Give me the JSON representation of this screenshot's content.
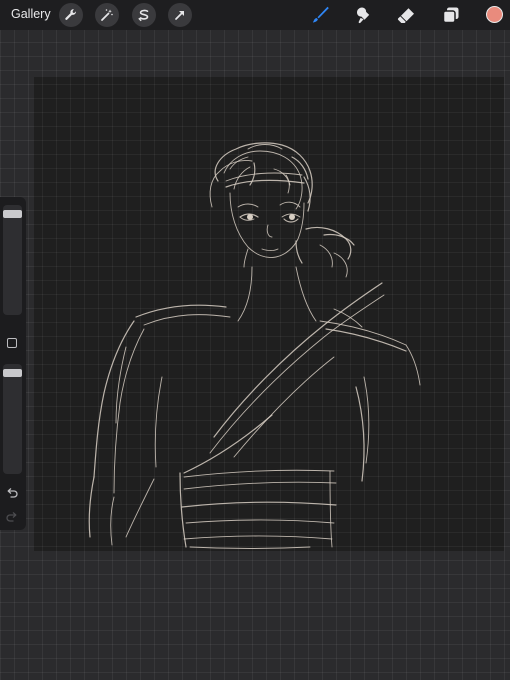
{
  "toolbar": {
    "gallery_label": "Gallery",
    "left_tools": [
      "wrench-icon",
      "magic-wand-icon",
      "selection-icon",
      "transform-arrow-icon"
    ],
    "right_tools": [
      "brush-icon",
      "smudge-icon",
      "eraser-icon",
      "layers-icon"
    ],
    "active_tool": "brush",
    "active_color": "#e98b7d",
    "accent_color": "#2f86f5"
  },
  "sidebar": {
    "brush_size": 0.05,
    "brush_opacity": 0.05,
    "modify_button_icon": "square-icon",
    "undo_icon": "undo-icon",
    "redo_icon": "redo-icon"
  },
  "canvas": {
    "content": "line-art-sketch",
    "stroke_color": "#d8cfc4"
  }
}
